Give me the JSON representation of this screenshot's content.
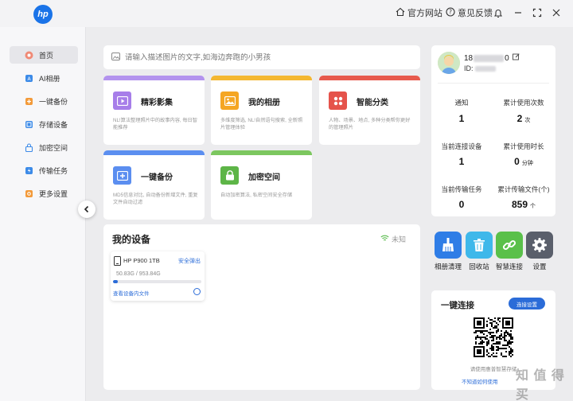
{
  "app": {
    "logo_text": "hp"
  },
  "titlebar": {
    "website": "官方网站",
    "feedback": "意见反馈"
  },
  "sidebar": {
    "items": [
      {
        "label": "首页",
        "icon": "home-icon",
        "active": true
      },
      {
        "label": "AI相册",
        "icon": "ai-album-icon"
      },
      {
        "label": "一键备份",
        "icon": "backup-icon"
      },
      {
        "label": "存储设备",
        "icon": "storage-icon"
      },
      {
        "label": "加密空间",
        "icon": "encrypted-space-icon"
      },
      {
        "label": "传输任务",
        "icon": "transfer-icon"
      },
      {
        "label": "更多设置",
        "icon": "settings-icon"
      }
    ]
  },
  "search": {
    "placeholder": "请输入描述图片的文字,如海边奔跑的小男孩"
  },
  "cards": [
    {
      "title": "精彩影集",
      "desc": "NL!算法整理照片中的故事内容, 每日智能推荐",
      "color": "#b393ee"
    },
    {
      "title": "我的相册",
      "desc": "多维度筛选, NL!自然语句搜索, 全新照片管理体验",
      "color": "#f4b731"
    },
    {
      "title": "智能分类",
      "desc": "人物、场景、地点, 多种分类帮你更好的管理照片",
      "color": "#e75a4d"
    },
    {
      "title": "一键备份",
      "desc": "MD5信息对比, 自动备份新增文件, 重复文件自动过滤",
      "color": "#5c8ff0"
    },
    {
      "title": "加密空间",
      "desc": "自动加密算法, 私密空间安全存储",
      "color": "#7cc75f"
    }
  ],
  "devices": {
    "title": "我的设备",
    "status": "未知",
    "device": {
      "name": "HP P900 1TB",
      "eject": "安全弹出",
      "usage": "50.83G / 953.84G",
      "usage_fraction": 0.053,
      "view": "查看设备内文件"
    }
  },
  "user": {
    "name": "18",
    "name_suffix": "0",
    "id_label": "ID:"
  },
  "stats": [
    {
      "label": "通知",
      "value": "1",
      "unit": ""
    },
    {
      "label": "累计使用次数",
      "value": "2",
      "unit": "次"
    },
    {
      "label": "当前连接设备",
      "value": "1",
      "unit": ""
    },
    {
      "label": "累计使用时长",
      "value": "0",
      "unit": "分钟"
    },
    {
      "label": "当前传输任务",
      "value": "0",
      "unit": ""
    },
    {
      "label": "累计传输文件(个)",
      "value": "859",
      "unit": "个"
    }
  ],
  "quick_actions": [
    {
      "label": "相册清理",
      "color": "#2f7de6"
    },
    {
      "label": "回收站",
      "color": "#3fb8ea"
    },
    {
      "label": "智慧连接",
      "color": "#5ac04a"
    },
    {
      "label": "设置",
      "color": "#5a5f6b"
    }
  ],
  "onekey": {
    "title": "一键连接",
    "button": "连接设置",
    "note": "请使用惠普智慧存储",
    "link": "不知道如何使用"
  },
  "watermark": "知 值 得 买"
}
